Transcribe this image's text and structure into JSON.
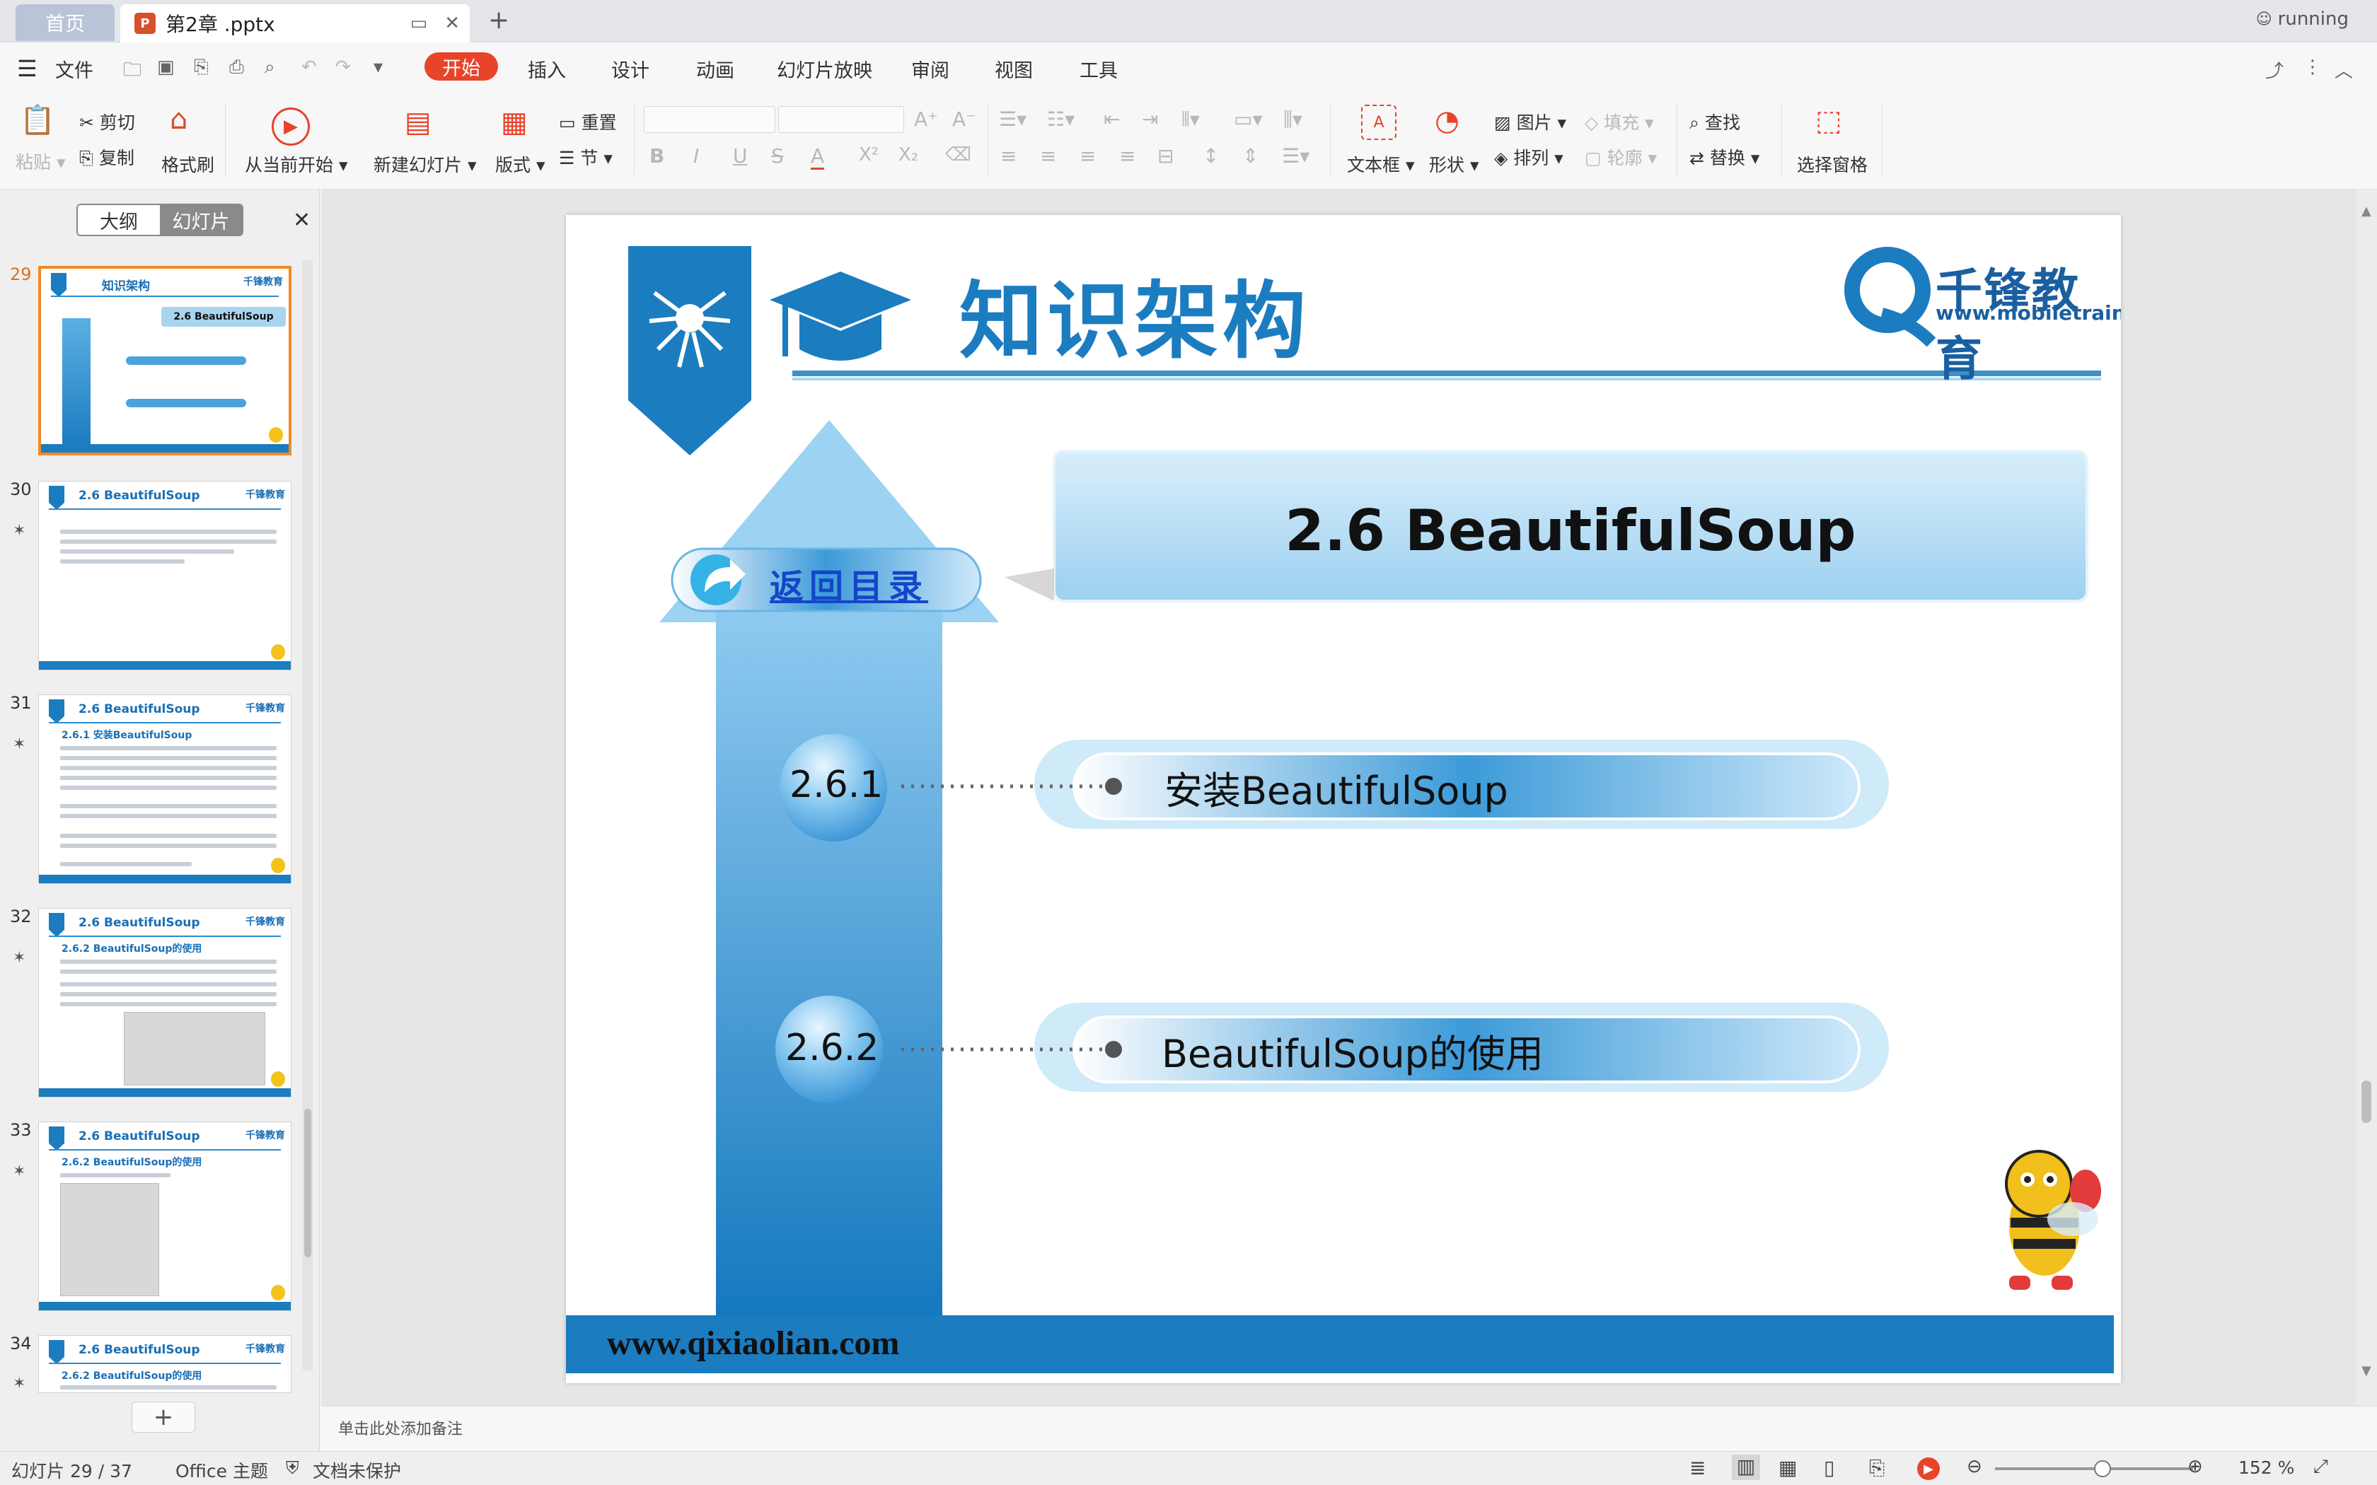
{
  "tabs": {
    "home": "首页",
    "doc": "第2章 .pptx",
    "badge": "P"
  },
  "status_top": "running",
  "menu": {
    "file": "文件",
    "items": [
      "开始",
      "插入",
      "设计",
      "动画",
      "幻灯片放映",
      "审阅",
      "视图",
      "工具"
    ]
  },
  "ribbon": {
    "paste": "粘贴",
    "cut": "剪切",
    "copy": "复制",
    "format_painter": "格式刷",
    "play_from_current": "从当前开始",
    "new_slide": "新建幻灯片",
    "layout": "版式",
    "reset": "重置",
    "section": "节",
    "textbox": "文本框",
    "shape": "形状",
    "picture": "图片",
    "arrange": "排列",
    "fill": "填充",
    "outline": "轮廓",
    "find": "查找",
    "replace": "替换",
    "select_pane": "选择窗格"
  },
  "leftpane": {
    "outline": "大纲",
    "slides": "幻灯片"
  },
  "thumbs": [
    {
      "num": "29",
      "title": "知识架构",
      "sub": "2.6 BeautifulSoup"
    },
    {
      "num": "30",
      "title": "2.6 BeautifulSoup"
    },
    {
      "num": "31",
      "title": "2.6 BeautifulSoup",
      "sub": "2.6.1 安装BeautifulSoup"
    },
    {
      "num": "32",
      "title": "2.6 BeautifulSoup",
      "sub": "2.6.2 BeautifulSoup的使用"
    },
    {
      "num": "33",
      "title": "2.6 BeautifulSoup",
      "sub": "2.6.2 BeautifulSoup的使用"
    },
    {
      "num": "34",
      "title": "2.6 BeautifulSoup",
      "sub": "2.6.2 BeautifulSoup的使用"
    }
  ],
  "slide": {
    "header": "知识架构",
    "logo_name": "千锋教育",
    "logo_url": "www.mobiletrain.org",
    "back_link": "返回目录",
    "section_title": "2.6 BeautifulSoup",
    "items": [
      {
        "num": "2.6.1",
        "label": "安装BeautifulSoup"
      },
      {
        "num": "2.6.2",
        "label": "BeautifulSoup的使用"
      }
    ],
    "footer_url": "www.qixiaolian.com"
  },
  "notes_placeholder": "单击此处添加备注",
  "status": {
    "slide_counter": "幻灯片 29 / 37",
    "theme": "Office 主题",
    "protect": "文档未保护",
    "zoom": "152 %"
  },
  "colors": {
    "accent": "#e8432b",
    "slide_blue": "#1c7cc0",
    "selection": "#f08a24"
  }
}
